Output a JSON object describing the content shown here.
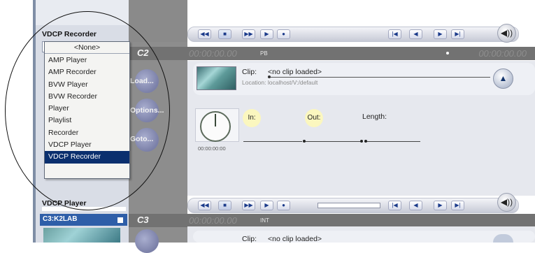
{
  "left_panel": {
    "selector_label": "VDCP Recorder",
    "selected_option": "<None>",
    "options": [
      "AMP Player",
      "AMP Recorder",
      "BVW Player",
      "BVW Recorder",
      "Player",
      "Playlist",
      "Recorder",
      "VDCP Player",
      "VDCP Recorder"
    ],
    "highlighted_option": "VDCP Recorder",
    "second_selector_label": "VDCP Player",
    "c3_header": "C3:K2LAB"
  },
  "side_buttons": {
    "load": "Load...",
    "options": "Options...",
    "goto": "Goto..."
  },
  "channels": [
    {
      "id": "C2",
      "timecode": "00:00:00.00",
      "mode": "PB",
      "timecode_right": "00:00:00.00"
    },
    {
      "id": "C3",
      "timecode": "00:00:00.00",
      "mode": "INT"
    }
  ],
  "transport": {
    "buttons": [
      "◀◀",
      "■",
      "▶▶",
      "▶",
      "●"
    ],
    "right_buttons": [
      "|◀",
      "◀",
      "▶",
      "▶|"
    ],
    "volume_icon": "◀))",
    "eject_icon": "▲"
  },
  "clip": {
    "clip_label": "Clip:",
    "clip_value": "<no clip loaded>",
    "location_label": "Location: localhost/V:/default",
    "in_label": "In:",
    "out_label": "Out:",
    "length_label": "Length:",
    "clock_time": "00:00:00:00"
  },
  "clip_c3": {
    "clip_label": "Clip:",
    "clip_value": "<no clip loaded>"
  },
  "colors": {
    "dropdown_highlight": "#0a2f6e",
    "c3_header_bg": "#2e5ea8",
    "button_column": "#8d8d8d",
    "header_strip": "#727272"
  }
}
